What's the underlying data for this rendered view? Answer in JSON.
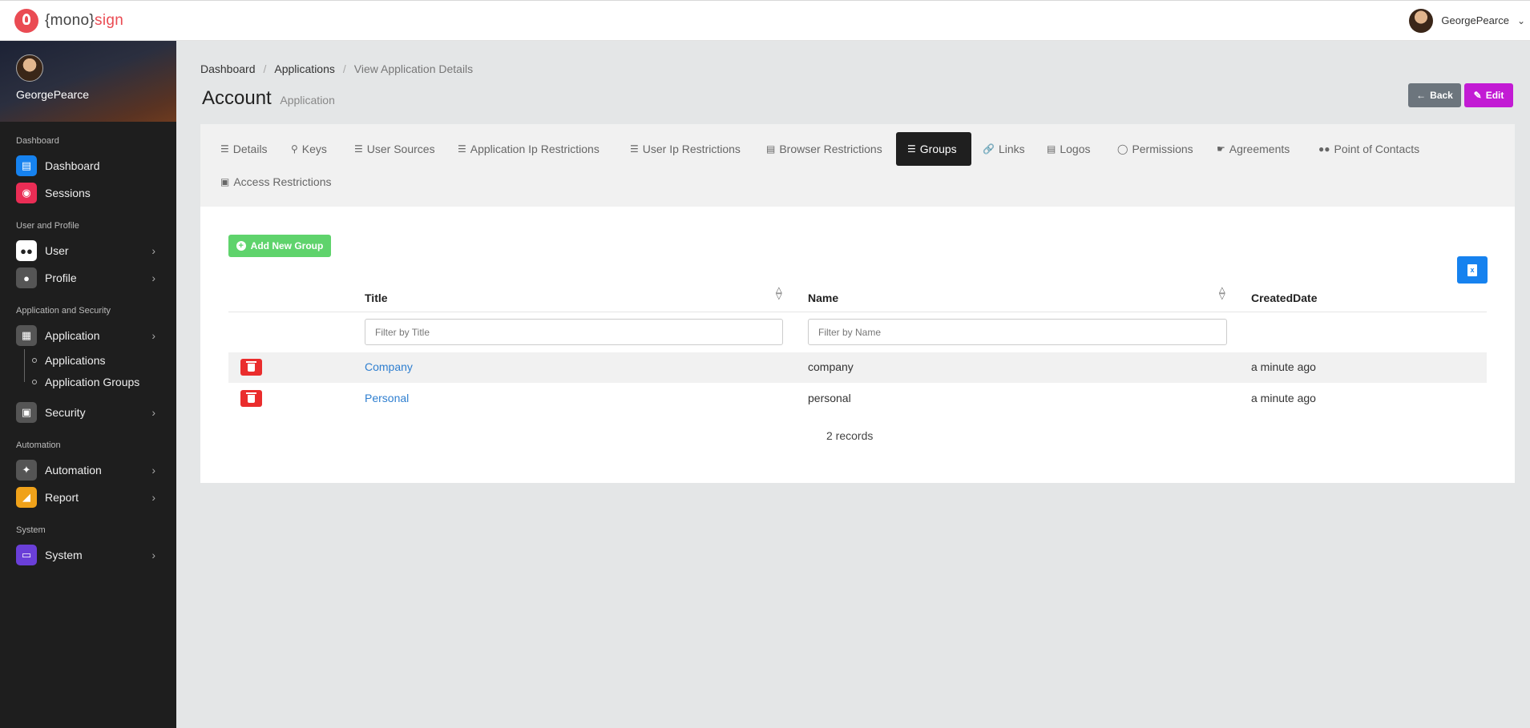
{
  "app": {
    "logo_prefix": "{mono}",
    "logo_brand": "sign"
  },
  "topbar": {
    "username": "GeorgePearce"
  },
  "sidebar": {
    "username": "GeorgePearce",
    "sections": {
      "dashboard": "Dashboard",
      "user_profile": "User and Profile",
      "app_security": "Application and Security",
      "automation": "Automation",
      "system": "System"
    },
    "items": {
      "dashboard": "Dashboard",
      "sessions": "Sessions",
      "user": "User",
      "profile": "Profile",
      "application": "Application",
      "applications": "Applications",
      "application_groups": "Application Groups",
      "security": "Security",
      "automation": "Automation",
      "report": "Report",
      "system": "System"
    }
  },
  "breadcrumb": {
    "item1": "Dashboard",
    "item2": "Applications",
    "item3": "View Application Details"
  },
  "page": {
    "title": "Account",
    "subtitle": "Application",
    "back_label": "Back",
    "edit_label": "Edit"
  },
  "tabs": {
    "details": "Details",
    "keys": "Keys",
    "user_sources": "User Sources",
    "app_ip": "Application Ip Restrictions",
    "user_ip": "User Ip Restrictions",
    "browser": "Browser Restrictions",
    "groups": "Groups",
    "links": "Links",
    "logos": "Logos",
    "permissions": "Permissions",
    "agreements": "Agreements",
    "contacts": "Point of Contacts",
    "access": "Access Restrictions"
  },
  "groups": {
    "add_label": "Add New Group",
    "columns": {
      "title": "Title",
      "name": "Name",
      "created": "CreatedDate"
    },
    "filters": {
      "title_placeholder": "Filter by Title",
      "name_placeholder": "Filter by Name"
    },
    "rows": [
      {
        "title": "Company",
        "name": "company",
        "created": "a minute ago"
      },
      {
        "title": "Personal",
        "name": "personal",
        "created": "a minute ago"
      }
    ],
    "records": "2 records"
  },
  "colors": {
    "brand": "#ea4b53",
    "edit": "#c21bd4",
    "add": "#5fd36c",
    "excel": "#1682ef",
    "delete": "#ea2d2d"
  }
}
